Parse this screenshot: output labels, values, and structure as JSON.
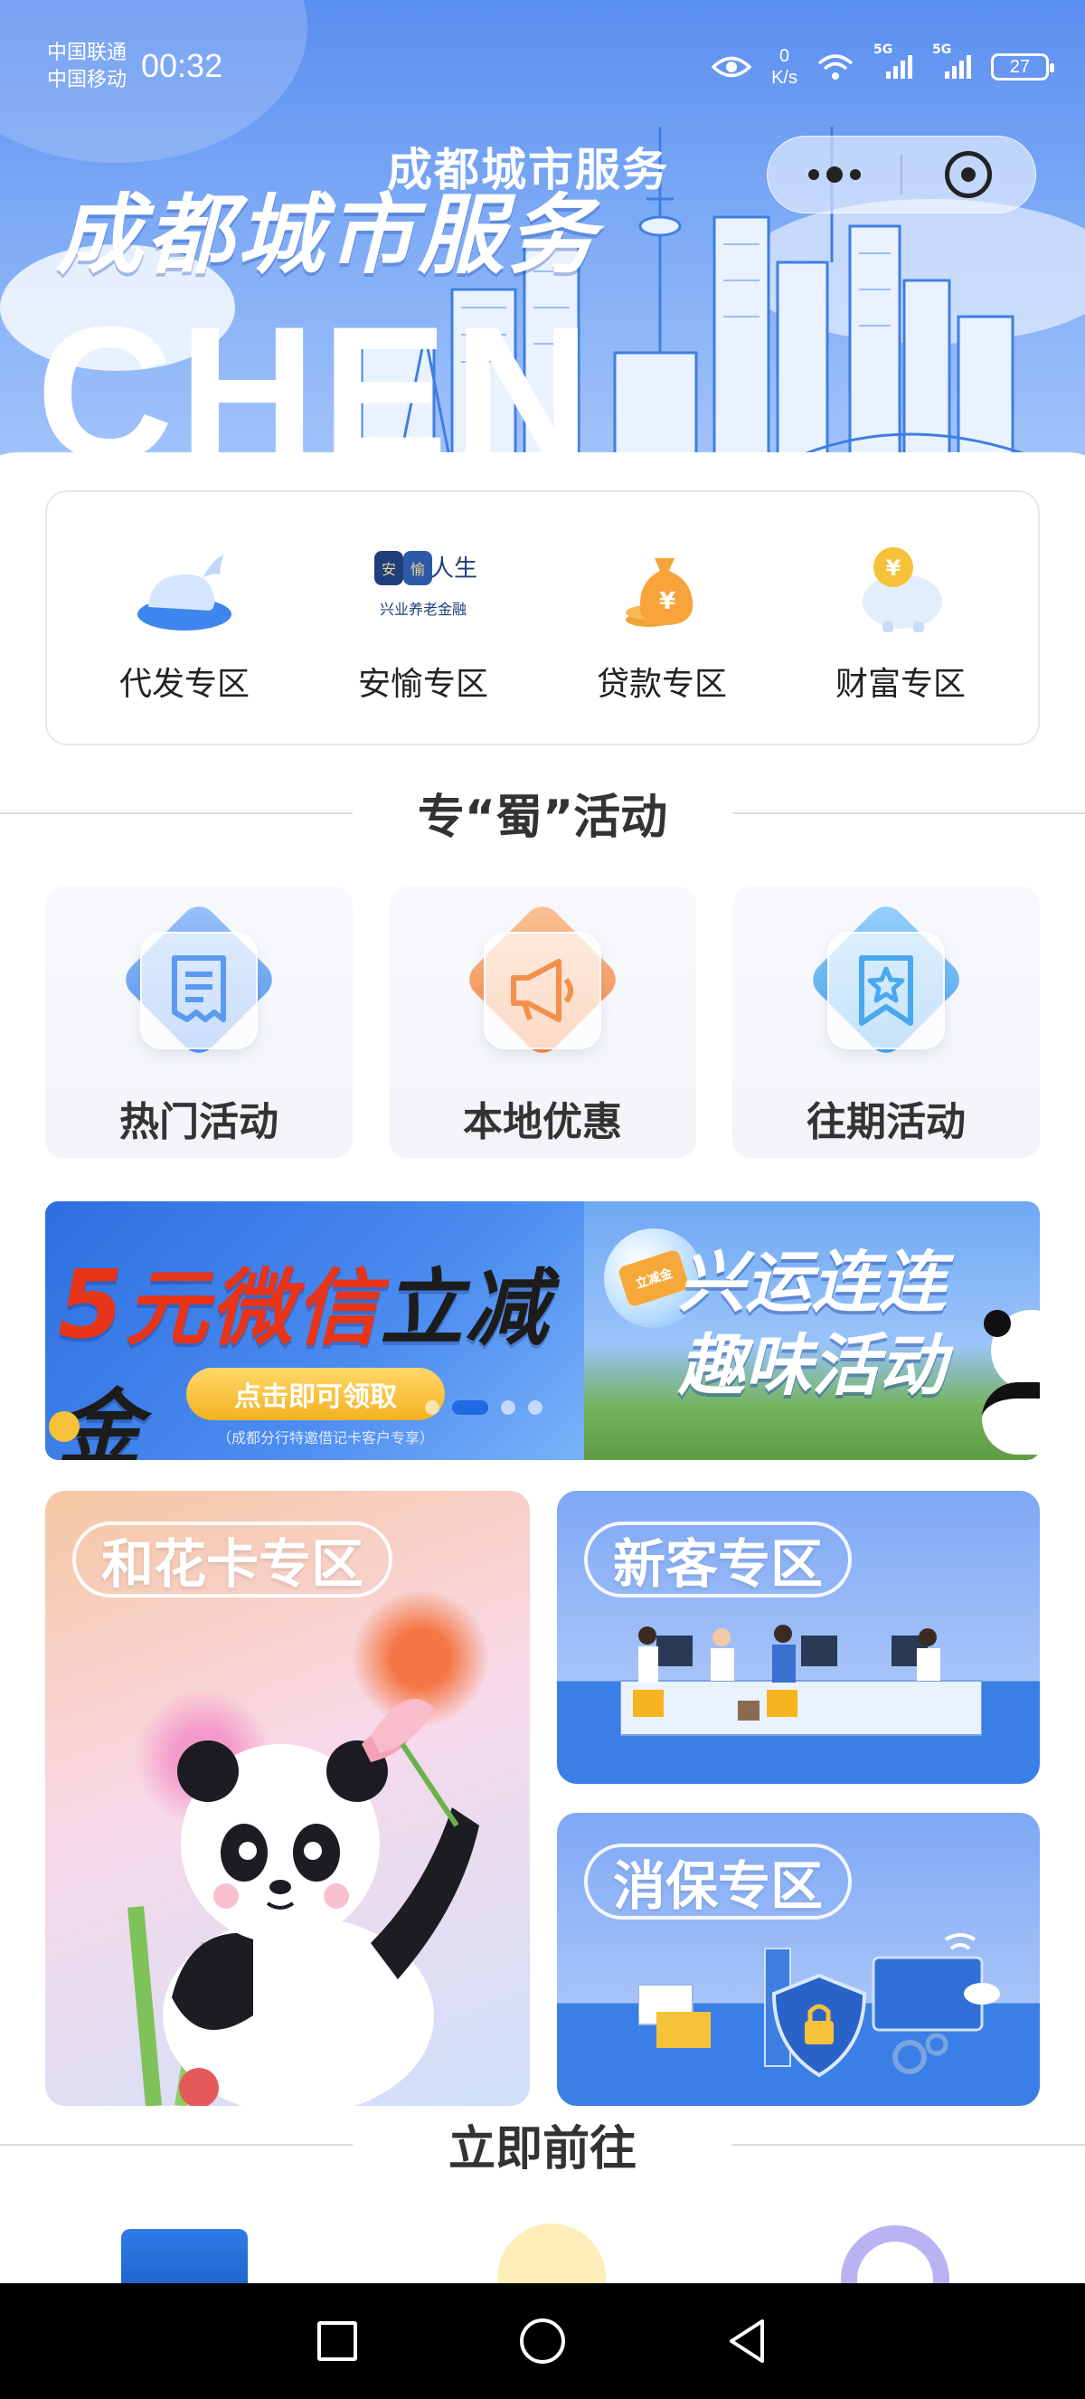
{
  "status_bar": {
    "carrier_1": "中国联通",
    "carrier_2": "中国移动",
    "time": "00:32",
    "net_speed_value": "0",
    "net_speed_unit": "K/s",
    "signal_1": "5G",
    "signal_2": "5G",
    "battery": "27"
  },
  "header": {
    "subtitle": "成都城市服务",
    "title": "成都城市服务",
    "background_text": "CHEN"
  },
  "quick_entries": [
    {
      "label": "代发专区",
      "icon": "whale-icon"
    },
    {
      "label": "安愉专区",
      "icon": "anyu-life-logo",
      "logo_text": "安愉人生",
      "logo_sub": "兴业养老金融"
    },
    {
      "label": "贷款专区",
      "icon": "money-bag-icon"
    },
    {
      "label": "财富专区",
      "icon": "piggy-bank-icon"
    }
  ],
  "sections": {
    "activities_title": "专“蜀”活动",
    "go_now_title": "立即前往"
  },
  "activities": [
    {
      "label": "热门活动",
      "icon": "receipt-icon",
      "color": "#5b9af0"
    },
    {
      "label": "本地优惠",
      "icon": "megaphone-icon",
      "color": "#f3904a"
    },
    {
      "label": "往期活动",
      "icon": "star-badge-icon",
      "color": "#4aa8f0"
    }
  ],
  "banner": {
    "slide1_num": "5",
    "slide1_red": "元微信",
    "slide1_dark": "立减金",
    "slide1_button": "点击即可领取",
    "slide1_note": "（成都分行特邀借记卡客户专享）",
    "slide2_line1": "兴运连连",
    "slide2_line2": "趣味活动",
    "slide2_badge": "立减金",
    "dots_count": 4,
    "active_index": 1
  },
  "zones": {
    "hehua": "和花卡专区",
    "xinke": "新客专区",
    "xiaobao": "消保专区"
  },
  "colors": {
    "primary_blue": "#1e6ae0",
    "hero_blue": "#5a8ef0"
  }
}
